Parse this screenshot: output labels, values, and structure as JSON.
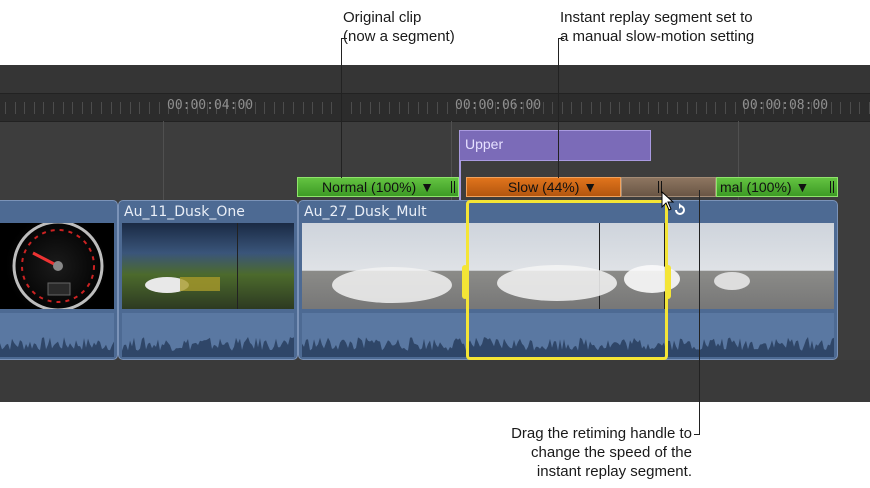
{
  "callouts": {
    "original_clip": [
      "Original clip",
      "(now a segment)"
    ],
    "instant_replay": [
      "Instant replay segment set to",
      "a manual slow-motion setting"
    ],
    "drag_handle": [
      "Drag the retiming handle to",
      "change the speed of the",
      "instant replay segment."
    ]
  },
  "ruler": {
    "timecodes": [
      "00:00:04:00",
      "00:00:06:00",
      "00:00:08:00"
    ]
  },
  "connected_clip": {
    "label": "Upper"
  },
  "retime_segments": {
    "normal_left": "Normal (100%) ▼",
    "slow": "Slow (44%) ▼",
    "normal_right": "mal (100%) ▼"
  },
  "clips": {
    "clip_1": {
      "name": ""
    },
    "clip_2": {
      "name": "Au_11_Dusk_One"
    },
    "clip_3": {
      "name": "Au_27_Dusk_Mult"
    }
  },
  "colors": {
    "retime_normal": "#4fae32",
    "retime_slow": "#d26a18",
    "retime_segment": "#7d6653",
    "primary_clip": "#4d6a93",
    "connected_clip": "#7b6bb8",
    "selection": "#f4e536"
  },
  "icons": [
    "retime-handle-icon",
    "retime-cursor-icon",
    "segment-grip-icon",
    "dropdown-arrow-icon"
  ]
}
